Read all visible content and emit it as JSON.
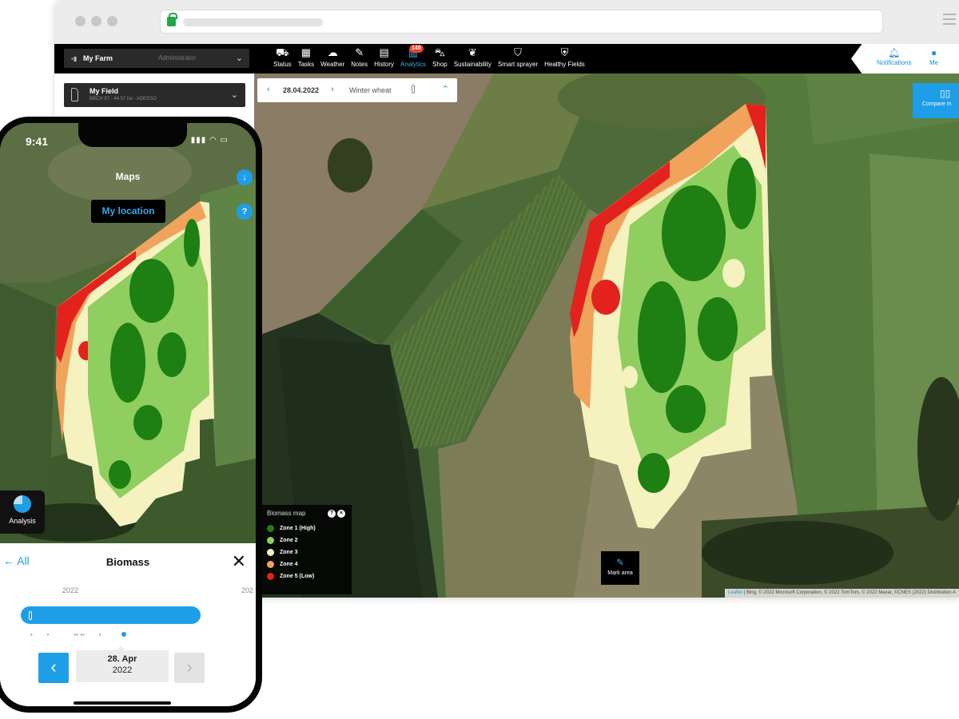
{
  "topnav": {
    "farm": {
      "name": "My Farm",
      "role": "Administrator"
    },
    "items": [
      {
        "label": "Status",
        "icon": "tractor-icon"
      },
      {
        "label": "Tasks",
        "icon": "calendar-icon"
      },
      {
        "label": "Weather",
        "icon": "weather-icon"
      },
      {
        "label": "Notes",
        "icon": "notes-icon"
      },
      {
        "label": "History",
        "icon": "history-icon"
      },
      {
        "label": "Analytics",
        "icon": "analytics-icon",
        "badge": "140",
        "active": true
      },
      {
        "label": "Shop",
        "icon": "cart-icon"
      },
      {
        "label": "Sustainability",
        "icon": "leaf-icon"
      },
      {
        "label": "Smart sprayer",
        "icon": "sprayer-icon"
      },
      {
        "label": "Healthy Fields",
        "icon": "shield-icon"
      }
    ],
    "notifications_label": "Notifications",
    "me_label": "Me"
  },
  "sidebar": {
    "field": {
      "name": "My Field",
      "sub": "BBCH 87 - 44.57 ha - ADESSO"
    }
  },
  "map": {
    "date": "28.04.2022",
    "crop": "Winter wheat",
    "compare_label": "Compare m",
    "mark_area_label": "Mark area",
    "attribution_link": "Leaflet",
    "attribution": "| Bing, © 2022 Microsoft Corporation, © 2022 TomTom, © 2022 Maxar, ©CNES (2022) Distribution A"
  },
  "legend": {
    "title": "Biomass map",
    "zones": [
      {
        "label": "Zone 1 (High)",
        "color": "#1e7f12"
      },
      {
        "label": "Zone 2",
        "color": "#8fce5f"
      },
      {
        "label": "Zone 3",
        "color": "#f5f2bf"
      },
      {
        "label": "Zone 4",
        "color": "#f1a35c"
      },
      {
        "label": "Zone 5 (Low)",
        "color": "#e3221d"
      }
    ]
  },
  "phone": {
    "time": "9:41",
    "title": "Maps",
    "my_location": "My location",
    "analysis_label": "Analysis",
    "sheet": {
      "back_label": "All",
      "title": "Biomass",
      "year_left": "2022",
      "year_right": "202",
      "date_day": "28. Apr",
      "date_year": "2022"
    }
  },
  "colors": {
    "accent": "#1f9ee8",
    "nav_bg": "#000000"
  }
}
